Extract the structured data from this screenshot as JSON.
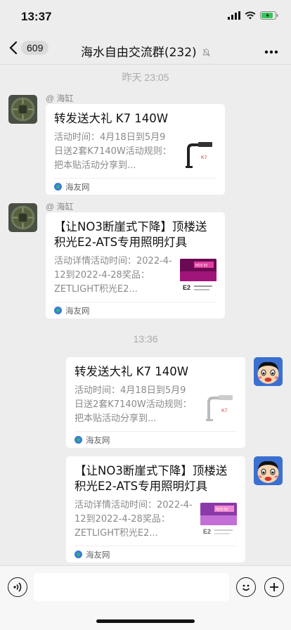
{
  "status": {
    "time": "13:37"
  },
  "nav": {
    "back_count": "609",
    "title": "海水自由交流群(232)"
  },
  "messages": {
    "sep1": "昨天 23:05",
    "sep2": "13:36",
    "m1": {
      "sender": "@ 海缸",
      "title": "转发送大礼 K7 140W",
      "desc": "活动时间：4月18日到5月9日送2套K7140W活动规则：把本贴活动分享到...",
      "source": "海友网"
    },
    "m2": {
      "sender": "@ 海缸",
      "title": "【让NO3断崖式下降】顶楼送积光E2-ATS专用照明灯具",
      "desc": "活动详情活动时间：2022-4-12到2022-4-28奖品：ZETLIGHT积光E2...",
      "source": "海友网"
    },
    "m3": {
      "title": "转发送大礼 K7 140W",
      "desc": "活动时间：4月18日到5月9日送2套K7140W活动规则：把本贴活动分享到...",
      "source": "海友网"
    },
    "m4": {
      "title": "【让NO3断崖式下降】顶楼送积光E2-ATS专用照明灯具",
      "desc": "活动详情活动时间：2022-4-12到2022-4-28奖品：ZETLIGHT积光E2...",
      "source": "海友网"
    }
  },
  "thumbs": {
    "k7_label": "K7",
    "e2_label": "E2",
    "e2_banner": "NO3 50"
  },
  "colors": {
    "background": "#ededed",
    "card": "#ffffff",
    "accent": "#07c160"
  }
}
